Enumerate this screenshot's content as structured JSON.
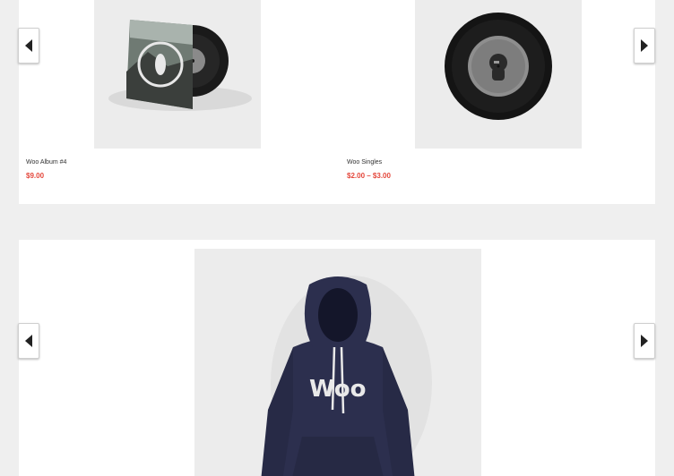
{
  "carousel_top": {
    "products": [
      {
        "title": "Woo Album #4",
        "price": "$9.00",
        "image_icon": "vinyl-album-image"
      },
      {
        "title": "Woo Singles",
        "price": "$2.00 – $3.00",
        "image_icon": "vinyl-single-image"
      }
    ],
    "prev_icon": "arrow-left-icon",
    "next_icon": "arrow-right-icon"
  },
  "carousel_bottom": {
    "products": [
      {
        "image_icon": "hoodie-image",
        "print_text": "Woo"
      }
    ],
    "prev_icon": "arrow-left-icon",
    "next_icon": "arrow-right-icon"
  },
  "colors": {
    "page_bg": "#efefef",
    "panel_bg": "#ffffff",
    "price": "#e4473b",
    "thumb_bg": "#ececec",
    "hoodie": "#2c2f4e"
  }
}
